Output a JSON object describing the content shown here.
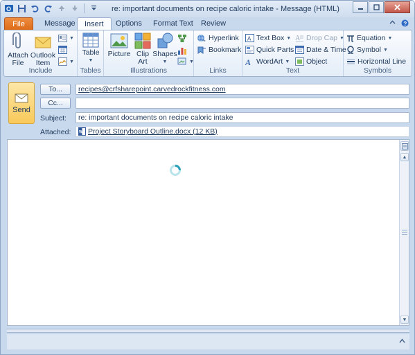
{
  "window": {
    "title": "re: important documents on recipe caloric intake  -  Message (HTML)"
  },
  "qat": {
    "icons": [
      "outlook-logo-icon",
      "save-icon",
      "undo-icon",
      "redo-icon",
      "up-arrow-icon",
      "down-arrow-icon",
      "customize-qat-icon"
    ]
  },
  "tabs": [
    {
      "label": "File"
    },
    {
      "label": "Message"
    },
    {
      "label": "Insert"
    },
    {
      "label": "Options"
    },
    {
      "label": "Format Text"
    },
    {
      "label": "Review"
    }
  ],
  "active_tab": "Insert",
  "ribbon": {
    "include": {
      "label": "Include",
      "attach_file": "Attach\nFile",
      "outlook_item": "Outlook\nItem"
    },
    "tables": {
      "label": "Tables",
      "table": "Table"
    },
    "illustrations": {
      "label": "Illustrations",
      "picture": "Picture",
      "clip_art": "Clip\nArt",
      "shapes": "Shapes"
    },
    "links": {
      "label": "Links",
      "hyperlink": "Hyperlink",
      "bookmark": "Bookmark"
    },
    "text": {
      "label": "Text",
      "text_box": "Text Box",
      "quick_parts": "Quick Parts",
      "wordart": "WordArt",
      "drop_cap": "Drop Cap",
      "date_time": "Date & Time",
      "object": "Object"
    },
    "symbols": {
      "label": "Symbols",
      "equation": "Equation",
      "symbol": "Symbol",
      "horizontal_line": "Horizontal Line"
    }
  },
  "compose": {
    "send_label": "Send",
    "to_label": "To...",
    "cc_label": "Cc...",
    "subject_label": "Subject:",
    "attached_label": "Attached:",
    "to_value": "recipes@crfsharepoint.carvedrockfitness.com",
    "cc_value": "",
    "subject_value": "re: important documents on recipe caloric intake",
    "attachment": "Project Storyboard Outline.docx (12 KB)"
  },
  "colors": {
    "file_tab": "#dc6a18",
    "ribbon_bg": "#e4edf8",
    "send_button": "#f9c95a",
    "frame": "#c9d9ed"
  }
}
